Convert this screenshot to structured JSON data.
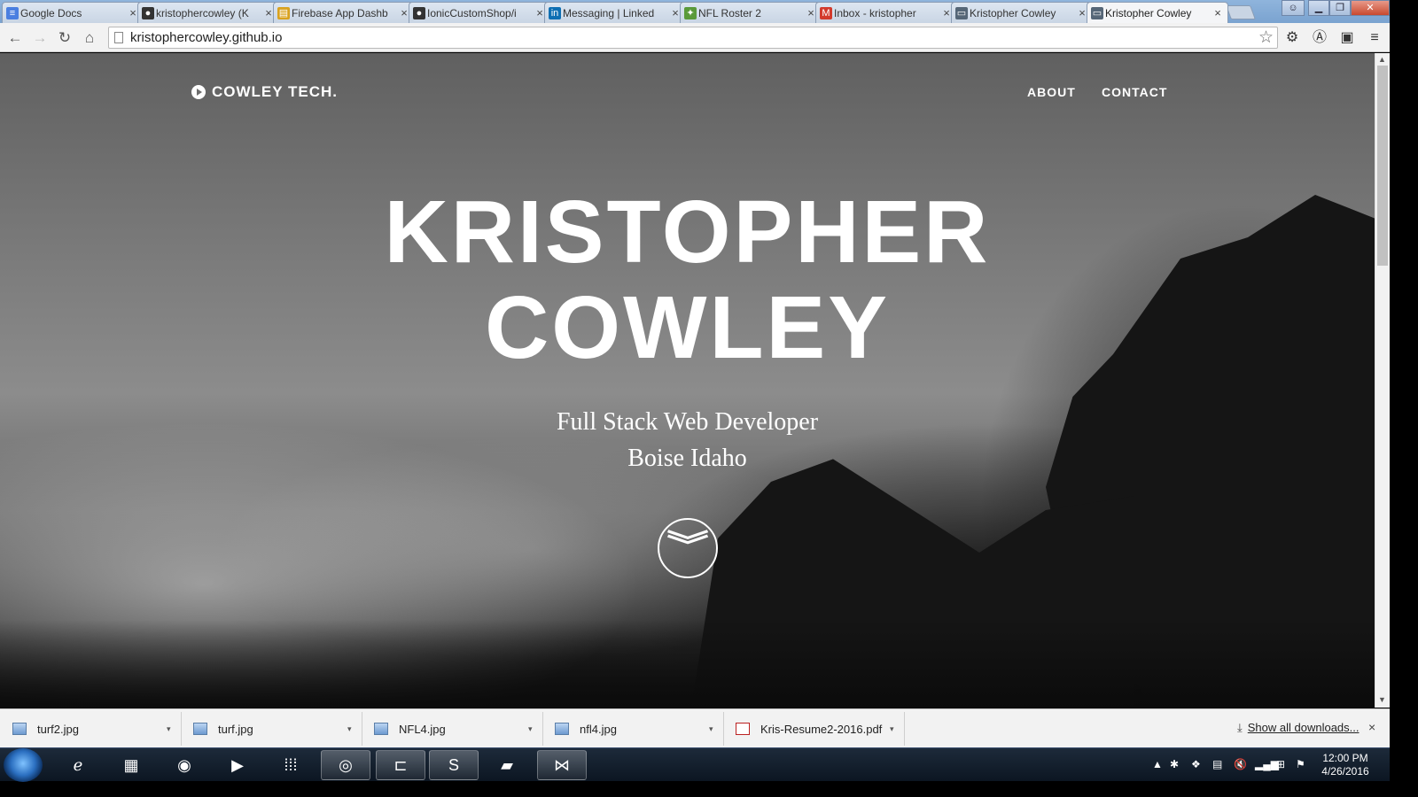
{
  "browser": {
    "tabs": [
      {
        "label": "Google Docs",
        "icon": "docs-icon",
        "color": "#4a7fe0",
        "glyph": "≡"
      },
      {
        "label": "kristophercowley (K",
        "icon": "github-icon",
        "color": "#333333",
        "glyph": "●"
      },
      {
        "label": "Firebase App Dashb",
        "icon": "firebase-icon",
        "color": "#d9a21f",
        "glyph": "▤"
      },
      {
        "label": "IonicCustomShop/i",
        "icon": "github-icon",
        "color": "#333333",
        "glyph": "●"
      },
      {
        "label": "Messaging | Linked",
        "icon": "linkedin-icon",
        "color": "#0e6fb3",
        "glyph": "in"
      },
      {
        "label": "NFL Roster 2",
        "icon": "puzzle-icon",
        "color": "#5a9a3a",
        "glyph": "✦"
      },
      {
        "label": "Inbox - kristopher",
        "icon": "gmail-icon",
        "color": "#d33a2c",
        "glyph": "M"
      },
      {
        "label": "Kristopher Cowley",
        "icon": "laptop-icon",
        "color": "#556677",
        "glyph": "▭"
      },
      {
        "label": "Kristopher Cowley",
        "icon": "laptop-icon",
        "color": "#556677",
        "glyph": "▭"
      }
    ],
    "tab_close": "×",
    "url": "kristophercowley.github.io"
  },
  "site": {
    "brand": "COWLEY TECH.",
    "nav": {
      "about": "ABOUT",
      "contact": "CONTACT"
    },
    "hero_name_line1": "KRISTOPHER",
    "hero_name_line2": "COWLEY",
    "hero_role": "Full Stack Web Developer",
    "hero_location": "Boise Idaho"
  },
  "downloads": {
    "items": [
      {
        "label": "turf2.jpg",
        "type": "image"
      },
      {
        "label": "turf.jpg",
        "type": "image"
      },
      {
        "label": "NFL4.jpg",
        "type": "image"
      },
      {
        "label": "nfl4.jpg",
        "type": "image"
      },
      {
        "label": "Kris-Resume2-2016.pdf",
        "type": "pdf"
      }
    ],
    "show_all": "Show all downloads...",
    "close": "×"
  },
  "taskbar": {
    "time": "12:00 PM",
    "date": "4/26/2016"
  }
}
